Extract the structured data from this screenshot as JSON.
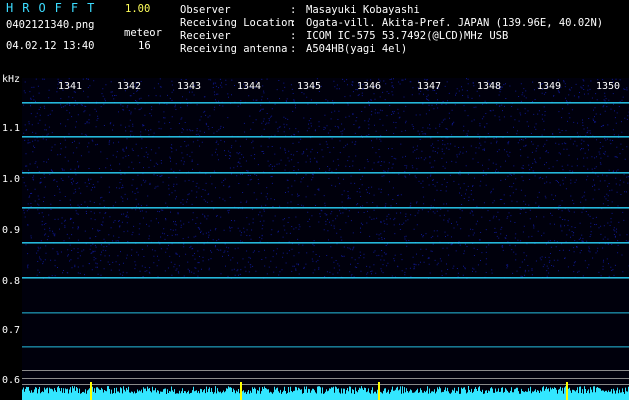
{
  "app": {
    "title": "HROFFT",
    "version": "1.00"
  },
  "file": {
    "name": "0402121340.png",
    "datetime": "04.02.12 13:40"
  },
  "meteor": {
    "label": "meteor",
    "count": "16"
  },
  "info": [
    {
      "key": "Observer",
      "value": "Masayuki Kobayashi"
    },
    {
      "key": "Receiving Location",
      "value": "Ogata-vill. Akita-Pref. JAPAN (139.96E, 40.02N)"
    },
    {
      "key": "Receiver",
      "value": "ICOM IC-575 53.7492(@LCD)MHz USB"
    },
    {
      "key": "Receiving antenna",
      "value": "A504HB(yagi 4el)"
    }
  ],
  "separator": ":",
  "y_axis": {
    "unit": "kHz",
    "ticks": [
      "1.1",
      "1.0",
      "0.9",
      "0.8",
      "0.7",
      "0.6"
    ]
  },
  "x_axis": {
    "ticks": [
      "1341",
      "1342",
      "1343",
      "1344",
      "1345",
      "1346",
      "1347",
      "1348",
      "1349",
      "1350"
    ]
  },
  "colors": {
    "title": "#3cdcff",
    "version": "#ffff5a",
    "signal": "#2ad8ff",
    "noise": "#1c2cff",
    "tick": "#ffff00"
  }
}
